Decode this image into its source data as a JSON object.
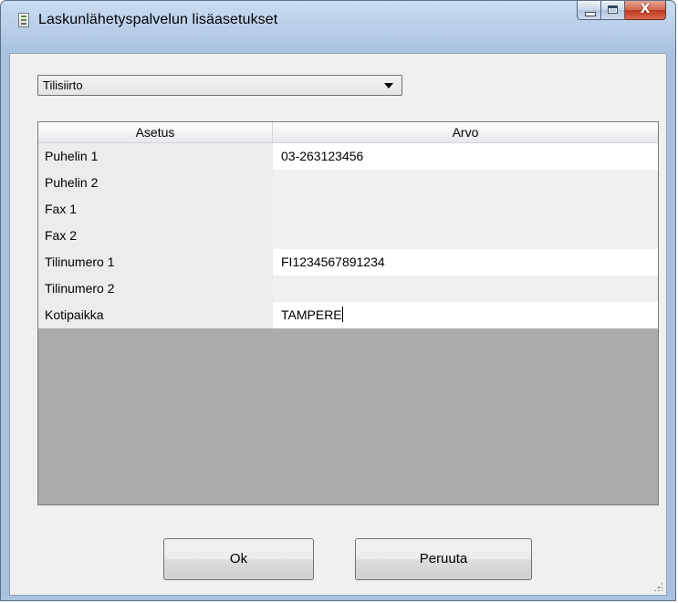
{
  "window": {
    "title": "Laskunlähetyspalvelun lisäasetukset",
    "close_glyph": "X",
    "icon": "app-document-icon"
  },
  "combo": {
    "selected": "Tilisiirto",
    "icon": "chevron-down-icon"
  },
  "grid": {
    "columns": [
      "Asetus",
      "Arvo"
    ],
    "rows": [
      {
        "setting": "Puhelin 1",
        "value": "03-263123456"
      },
      {
        "setting": "Puhelin 2",
        "value": ""
      },
      {
        "setting": "Fax 1",
        "value": ""
      },
      {
        "setting": "Fax 2",
        "value": ""
      },
      {
        "setting": "Tilinumero 1",
        "value": "FI1234567891234"
      },
      {
        "setting": "Tilinumero 2",
        "value": ""
      },
      {
        "setting": "Kotipaikka",
        "value": "TAMPERE"
      }
    ]
  },
  "buttons": {
    "ok": "Ok",
    "cancel": "Peruuta"
  }
}
